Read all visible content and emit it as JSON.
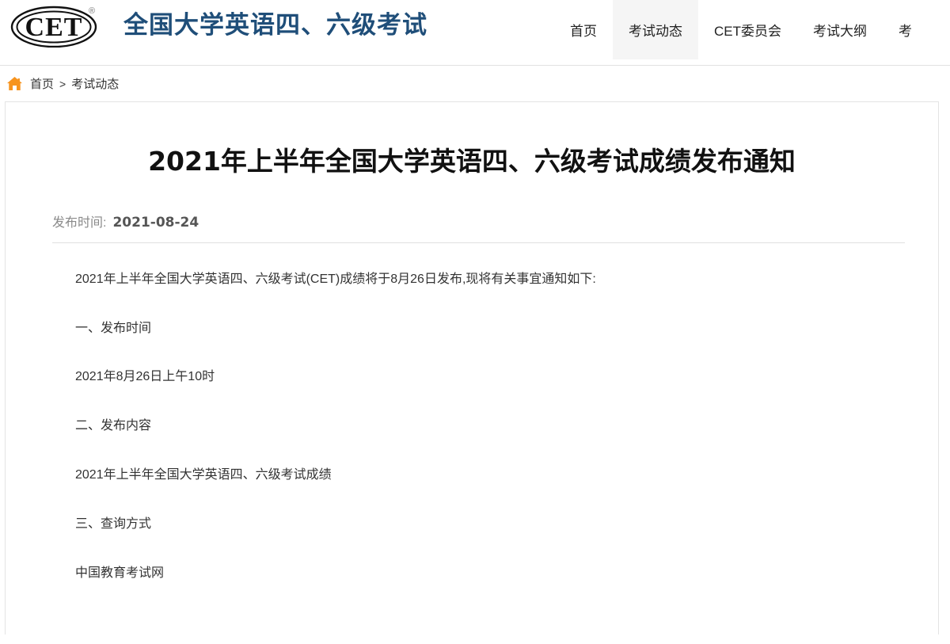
{
  "header": {
    "logo_text": "CET",
    "logo_registered_mark": "®",
    "brand_title": "全国大学英语四、六级考试",
    "brand_color": "#1f4e79",
    "nav": [
      {
        "label": "首页",
        "active": false
      },
      {
        "label": "考试动态",
        "active": true
      },
      {
        "label": "CET委员会",
        "active": false
      },
      {
        "label": "考试大纲",
        "active": false
      },
      {
        "label": "考",
        "active": false
      }
    ]
  },
  "breadcrumb": {
    "home_icon": "home-icon",
    "home_icon_color": "#f7941e",
    "items": [
      {
        "label": "首页",
        "link": true
      },
      {
        "label": "考试动态",
        "link": false
      }
    ],
    "separator": ">"
  },
  "article": {
    "title": "2021年上半年全国大学英语四、六级考试成绩发布通知",
    "meta": {
      "label": "发布时间:",
      "value": "2021-08-24"
    },
    "paragraphs": [
      "2021年上半年全国大学英语四、六级考试(CET)成绩将于8月26日发布,现将有关事宜通知如下:",
      "一、发布时间",
      "2021年8月26日上午10时",
      "二、发布内容",
      "2021年上半年全国大学英语四、六级考试成绩",
      "三、查询方式",
      "中国教育考试网"
    ]
  }
}
